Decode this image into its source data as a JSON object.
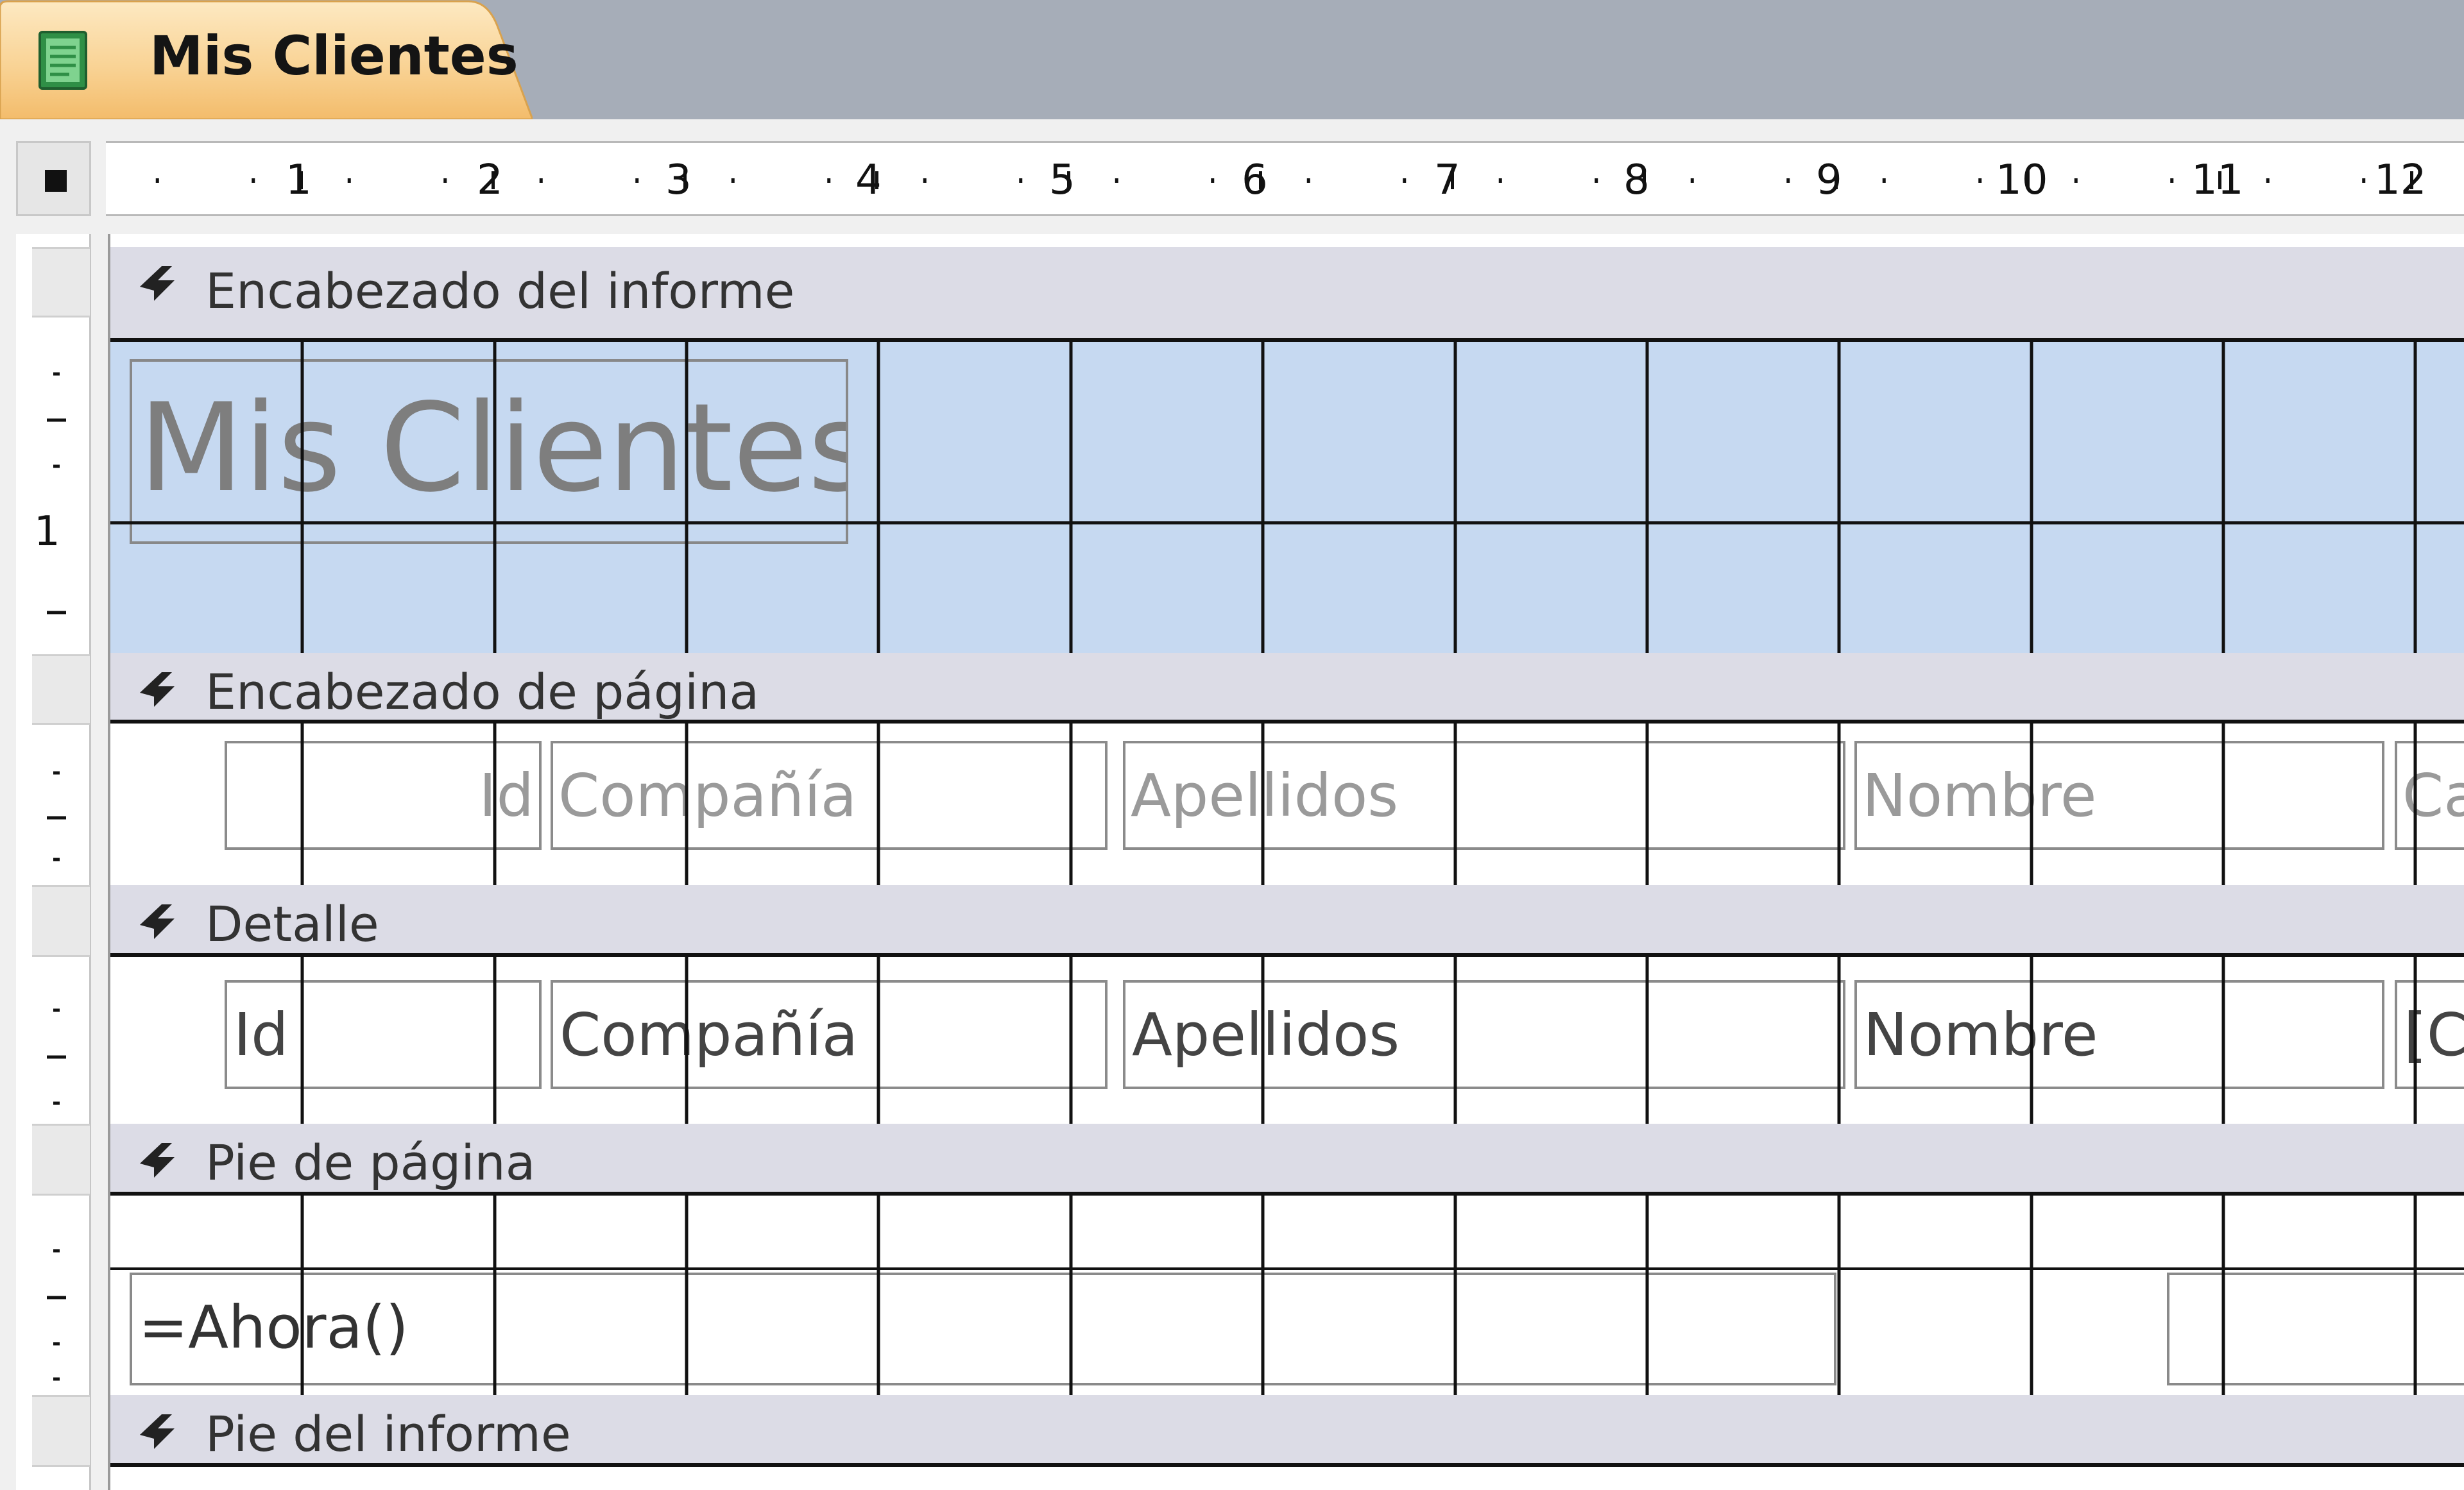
{
  "colors": {
    "tab_bg": "#a6adb8",
    "tab_active": "#f6c97e",
    "section_bar": "#dcdce6",
    "report_header_fill": "#c6d9f1",
    "grid_line": "#111111"
  },
  "tab": {
    "title": "Mis Clientes",
    "icon": "report-icon"
  },
  "ruler": {
    "horizontal_labels": [
      "1",
      "2",
      "3",
      "4",
      "5",
      "6",
      "7",
      "8",
      "9",
      "10",
      "11",
      "12"
    ],
    "vertical_labels": [
      "1"
    ]
  },
  "sections": {
    "report_header": {
      "label": "Encabezado del informe",
      "icon": "collapse-chevron-icon",
      "title_text": "Mis Clientes"
    },
    "page_header": {
      "label": "Encabezado de página",
      "icon": "collapse-chevron-icon",
      "labels": [
        "Id",
        "Compañía",
        "Apellidos",
        "Nombre",
        "Ca"
      ]
    },
    "detail": {
      "label": "Detalle",
      "icon": "collapse-chevron-icon",
      "fields": [
        "Id",
        "Compañía",
        "Apellidos",
        "Nombre",
        "[C"
      ]
    },
    "page_footer": {
      "label": "Pie de página",
      "icon": "collapse-chevron-icon",
      "expression": "=Ahora()"
    },
    "report_footer": {
      "label": "Pie del informe",
      "icon": "collapse-chevron-icon"
    }
  }
}
